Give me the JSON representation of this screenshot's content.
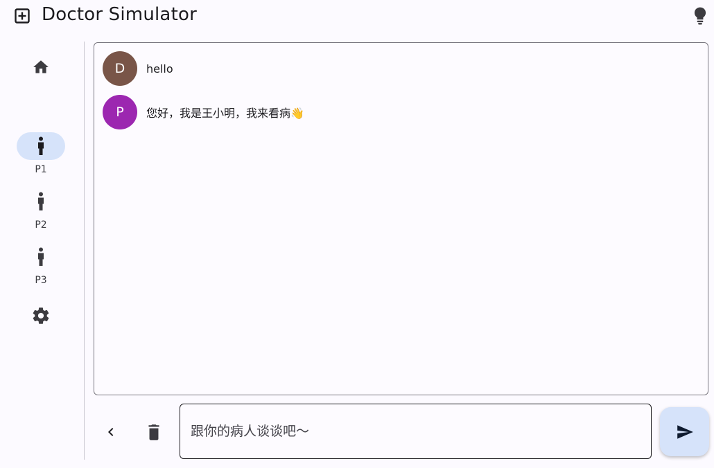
{
  "app": {
    "title": "Doctor Simulator"
  },
  "rail": {
    "home_icon": "home-icon",
    "items": [
      {
        "label": "P1",
        "icon": "person-icon",
        "active": true
      },
      {
        "label": "P2",
        "icon": "person-icon",
        "active": false
      },
      {
        "label": "P3",
        "icon": "person-icon",
        "active": false
      }
    ],
    "settings_icon": "gear-icon"
  },
  "messages": [
    {
      "avatar_letter": "D",
      "avatar_color": "#795548",
      "text": "hello"
    },
    {
      "avatar_letter": "P",
      "avatar_color": "#9c27b0",
      "text": "您好，我是王小明，我来看病👋"
    }
  ],
  "composer": {
    "placeholder": "跟你的病人谈谈吧～",
    "value": ""
  },
  "colors": {
    "accent": "#d6e3fa",
    "background": "#fcfaff"
  }
}
